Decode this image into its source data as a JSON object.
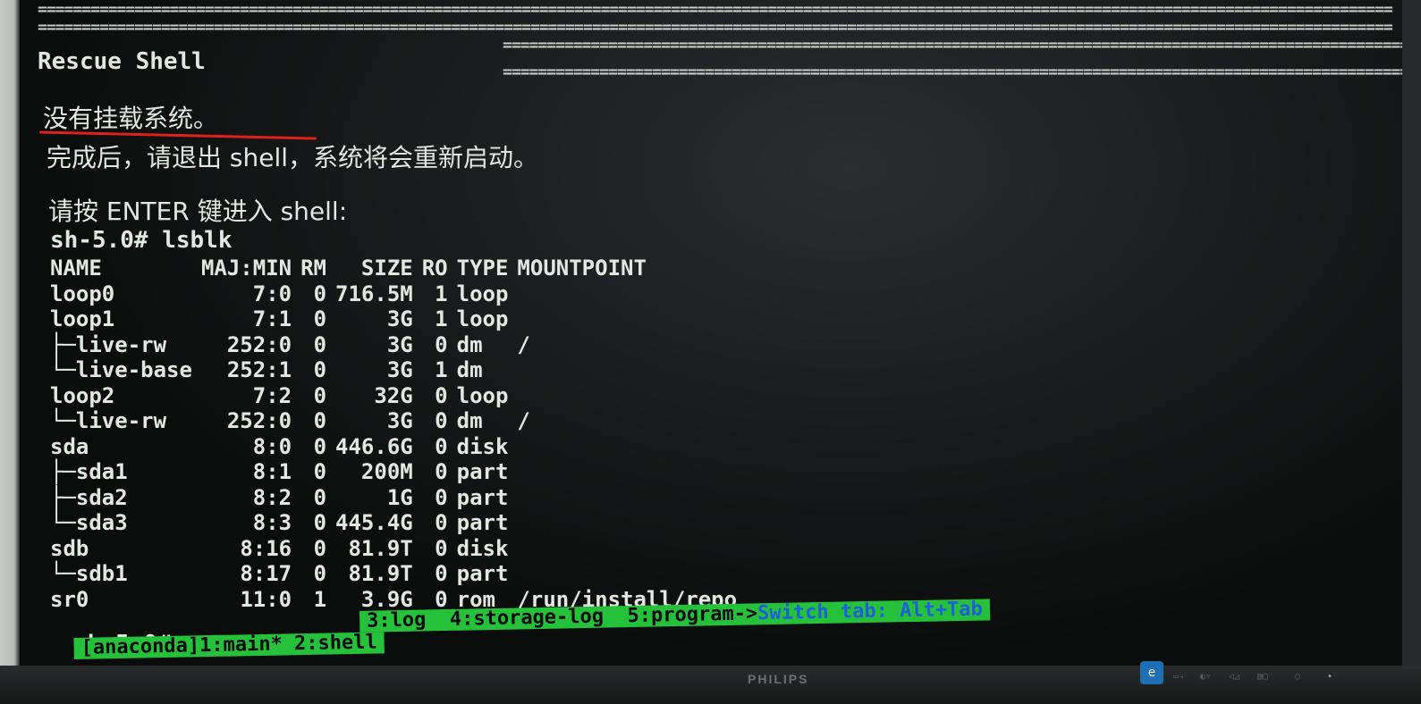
{
  "terminal": {
    "separator": "==========================================================================================================================================================",
    "title": "Rescue Shell",
    "msg_no_mount": "没有挂载系统。",
    "msg_reboot": "完成后，请退出 shell，系统将会重新启动。",
    "msg_press_enter": "请按 ENTER 键进入 shell:",
    "command_line": "sh-5.0# lsblk",
    "prompt_final": "sh-5.0#"
  },
  "lsblk": {
    "headers": [
      "NAME",
      "MAJ:MIN",
      "RM",
      "SIZE",
      "RO",
      "TYPE",
      "MOUNTPOINT"
    ],
    "rows": [
      [
        "loop0",
        "7:0",
        "0",
        "716.5M",
        "1",
        "loop",
        ""
      ],
      [
        "loop1",
        "7:1",
        "0",
        "3G",
        "1",
        "loop",
        ""
      ],
      [
        "├─live-rw",
        "252:0",
        "0",
        "3G",
        "0",
        "dm",
        "/"
      ],
      [
        "└─live-base",
        "252:1",
        "0",
        "3G",
        "1",
        "dm",
        ""
      ],
      [
        "loop2",
        "7:2",
        "0",
        "32G",
        "0",
        "loop",
        ""
      ],
      [
        "└─live-rw",
        "252:0",
        "0",
        "3G",
        "0",
        "dm",
        "/"
      ],
      [
        "sda",
        "8:0",
        "0",
        "446.6G",
        "0",
        "disk",
        ""
      ],
      [
        "├─sda1",
        "8:1",
        "0",
        "200M",
        "0",
        "part",
        ""
      ],
      [
        "├─sda2",
        "8:2",
        "0",
        "1G",
        "0",
        "part",
        ""
      ],
      [
        "└─sda3",
        "8:3",
        "0",
        "445.4G",
        "0",
        "part",
        ""
      ],
      [
        "sdb",
        "8:16",
        "0",
        "81.9T",
        "0",
        "disk",
        ""
      ],
      [
        "└─sdb1",
        "8:17",
        "0",
        "81.9T",
        "0",
        "part",
        ""
      ],
      [
        "sr0",
        "11:0",
        "1",
        "3.9G",
        "0",
        "rom",
        "/run/install/repo"
      ]
    ]
  },
  "tmux": {
    "tabs_line": "3:log  4:storage-log  5:program->",
    "switch_hint": "Switch tab: Alt+Tab",
    "session_line": "[anaconda]1:main* 2:shell"
  },
  "monitor": {
    "brand": "PHILIPS",
    "energy_icon": "energy-star-icon"
  },
  "colors": {
    "status_bg": "#25c13b",
    "hint_blue": "#1f5fd8",
    "underline_red": "#e0201c",
    "text": "#e4e6e2"
  }
}
